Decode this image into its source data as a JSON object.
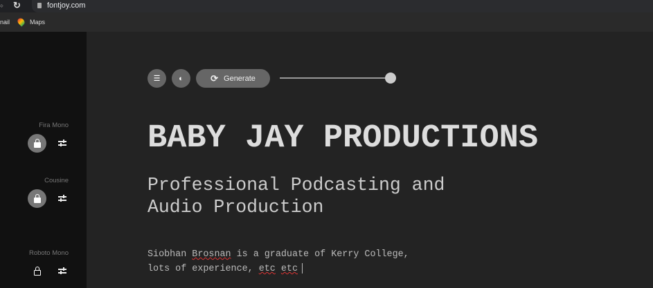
{
  "browser": {
    "url": "fontjoy.com",
    "bookmarks": [
      "nail",
      "Maps"
    ]
  },
  "sidebar": {
    "fonts": [
      {
        "name": "Fira Mono",
        "locked": true
      },
      {
        "name": "Cousine",
        "locked": true
      },
      {
        "name": "Roboto Mono",
        "locked": false
      }
    ]
  },
  "toolbar": {
    "generate_label": "Generate",
    "slider_value": 1.0
  },
  "content": {
    "title": "BABY JAY PRODUCTIONS",
    "subtitle": "Professional Podcasting and Audio Production",
    "body": {
      "part1": "Siobhan ",
      "misspelled1": "Brosnan",
      "part2": " is a graduate of Kerry College, lots of experience, ",
      "misspelled2": "etc",
      "space": " ",
      "misspelled3": "etc"
    }
  }
}
